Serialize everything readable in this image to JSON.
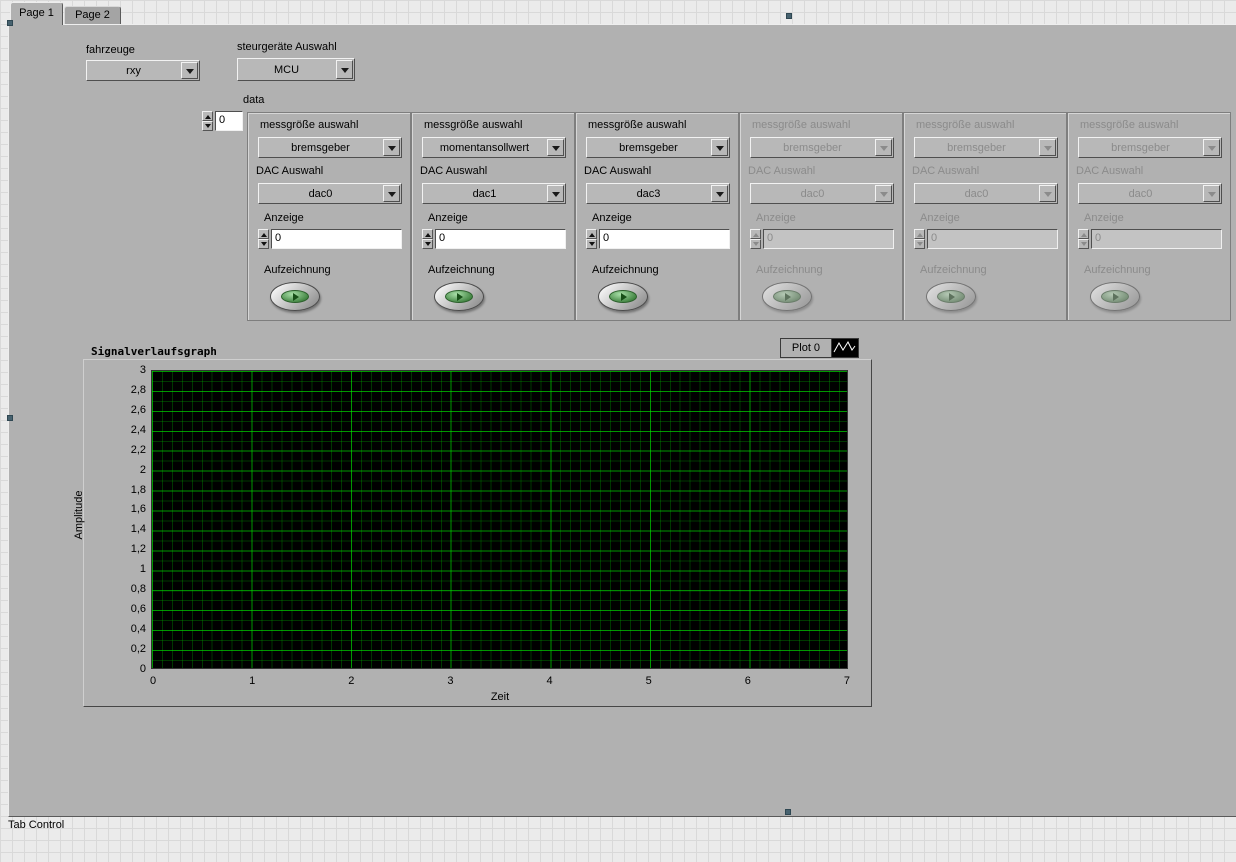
{
  "window": {
    "tab_control_label": "Tab Control"
  },
  "tabs": [
    {
      "label": "Page 1",
      "active": true
    },
    {
      "label": "Page 2",
      "active": false
    }
  ],
  "fahrzeuge": {
    "label": "fahrzeuge",
    "value": "rxy"
  },
  "steuergeraete": {
    "label": "steurgeräte Auswahl",
    "value": "MCU"
  },
  "data_array": {
    "label": "data",
    "index": "0"
  },
  "clusters": [
    {
      "messgroesse_label": "messgröße auswahl",
      "messgroesse_value": "bremsgeber",
      "dac_label": "DAC Auswahl",
      "dac_value": "dac0",
      "anzeige_label": "Anzeige",
      "anzeige_value": "0",
      "aufzeichnung_label": "Aufzeichnung",
      "enabled": true
    },
    {
      "messgroesse_label": "messgröße auswahl",
      "messgroesse_value": "momentansollwert",
      "dac_label": "DAC Auswahl",
      "dac_value": "dac1",
      "anzeige_label": "Anzeige",
      "anzeige_value": "0",
      "aufzeichnung_label": "Aufzeichnung",
      "enabled": true
    },
    {
      "messgroesse_label": "messgröße auswahl",
      "messgroesse_value": "bremsgeber",
      "dac_label": "DAC Auswahl",
      "dac_value": "dac3",
      "anzeige_label": "Anzeige",
      "anzeige_value": "0",
      "aufzeichnung_label": "Aufzeichnung",
      "enabled": true
    },
    {
      "messgroesse_label": "messgröße auswahl",
      "messgroesse_value": "bremsgeber",
      "dac_label": "DAC Auswahl",
      "dac_value": "dac0",
      "anzeige_label": "Anzeige",
      "anzeige_value": "0",
      "aufzeichnung_label": "Aufzeichnung",
      "enabled": false
    },
    {
      "messgroesse_label": "messgröße auswahl",
      "messgroesse_value": "bremsgeber",
      "dac_label": "DAC Auswahl",
      "dac_value": "dac0",
      "anzeige_label": "Anzeige",
      "anzeige_value": "0",
      "aufzeichnung_label": "Aufzeichnung",
      "enabled": false
    },
    {
      "messgroesse_label": "messgröße auswahl",
      "messgroesse_value": "bremsgeber",
      "dac_label": "DAC Auswahl",
      "dac_value": "dac0",
      "anzeige_label": "Anzeige",
      "anzeige_value": "0",
      "aufzeichnung_label": "Aufzeichnung",
      "enabled": false
    }
  ],
  "graph": {
    "title": "Signalverlaufsgraph",
    "legend_label": "Plot 0",
    "ylabel": "Amplitude",
    "xlabel": "Zeit",
    "y_ticks": [
      "3",
      "2,8",
      "2,6",
      "2,4",
      "2,2",
      "2",
      "1,8",
      "1,6",
      "1,4",
      "1,2",
      "1",
      "0,8",
      "0,6",
      "0,4",
      "0,2",
      "0"
    ],
    "x_ticks": [
      "0",
      "1",
      "2",
      "3",
      "4",
      "5",
      "6",
      "7"
    ],
    "x_range": [
      0,
      7
    ],
    "y_range": [
      0,
      3
    ],
    "plot_background": "#000000",
    "grid_color": "#00a000",
    "plot_line_color": "#ffffff",
    "has_data": false
  },
  "colors": {
    "panel": "#b1b1b1",
    "led_green": "#3c7f3c",
    "disabled_text": "#8b8b8b"
  }
}
